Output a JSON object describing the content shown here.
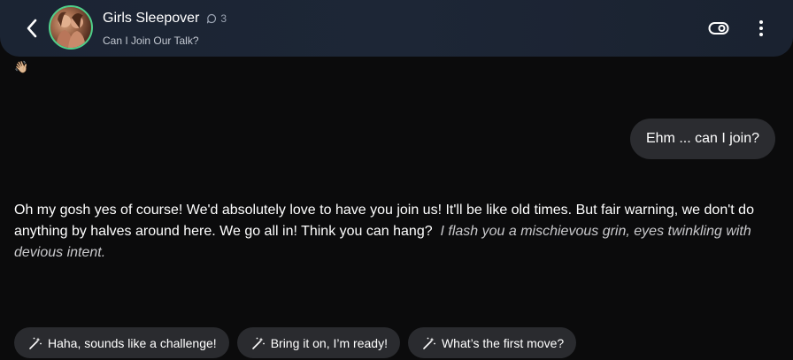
{
  "header": {
    "title": "Girls Sleepover",
    "message_count": "3",
    "subtitle": "Can I Join Our Talk?"
  },
  "messages": {
    "emoji_line": "👋🏼",
    "user_message": "Ehm ... can I join?",
    "ai_message": {
      "text": "Oh my gosh yes of course! We'd absolutely love to have you join us! It'll be like old times. But fair warning, we don't do anything by halves around here. We go all in! Think you can hang?",
      "action": "I flash you a mischievous grin, eyes twinkling with devious intent."
    }
  },
  "suggestions": [
    {
      "label": "Haha, sounds like a challenge!"
    },
    {
      "label": "Bring it on, I’m ready!"
    },
    {
      "label": "What’s the first move?"
    }
  ],
  "icons": {
    "back": "chevron-left-icon",
    "count": "chat-bubble-icon",
    "toggle": "toggle-icon",
    "menu": "more-vertical-icon",
    "suggestion": "magic-wand-icon"
  },
  "colors": {
    "background": "#0b0b0c",
    "header": "#1d2636",
    "avatar_ring": "#4fd08a",
    "bubble": "#2b2c30",
    "chip": "#2a2b2f"
  }
}
